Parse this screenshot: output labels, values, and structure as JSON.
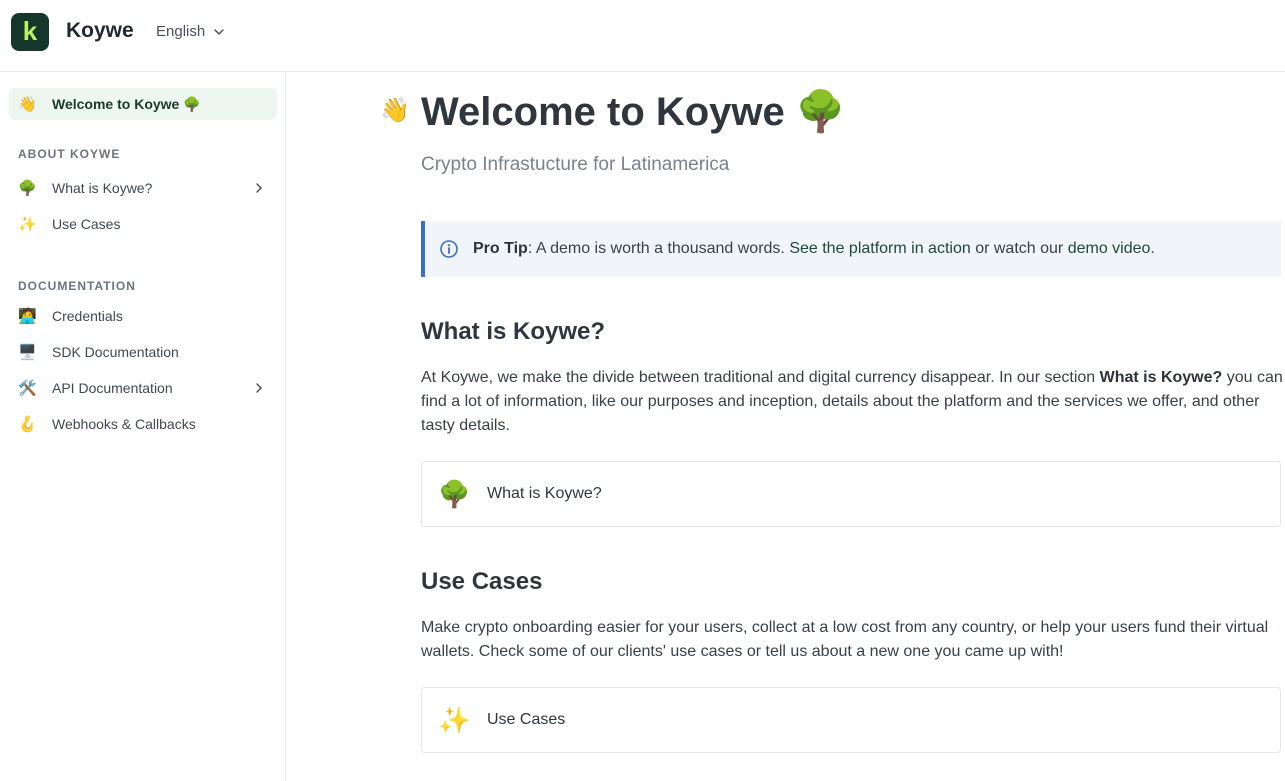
{
  "header": {
    "logo_letter": "k",
    "brand": "Koywe",
    "language": "English"
  },
  "sidebar": {
    "active": {
      "emoji": "👋",
      "label": "Welcome to Koywe 🌳"
    },
    "sections": [
      {
        "title": "ABOUT KOYWE",
        "items": [
          {
            "emoji": "🌳",
            "label": "What is Koywe?",
            "has_children": true
          },
          {
            "emoji": "✨",
            "label": "Use Cases",
            "has_children": false
          }
        ]
      },
      {
        "title": "DOCUMENTATION",
        "items": [
          {
            "emoji": "🧑‍💻",
            "label": "Credentials",
            "has_children": false
          },
          {
            "emoji": "🖥️",
            "label": "SDK Documentation",
            "has_children": false
          },
          {
            "emoji": "🛠️",
            "label": "API Documentation",
            "has_children": true
          },
          {
            "emoji": "🪝",
            "label": "Webhooks & Callbacks",
            "has_children": false
          }
        ]
      }
    ]
  },
  "main": {
    "title_emoji": "👋",
    "title": "Welcome to Koywe 🌳",
    "subtitle": "Crypto Infrastucture for Latinamerica",
    "callout": {
      "bold": "Pro Tip",
      "text_before": ": A demo is worth a thousand words. ",
      "link1": "See the platform in action",
      "text_mid": " or watch our ",
      "link2": "demo video",
      "text_after": "."
    },
    "section1": {
      "heading": "What is Koywe?",
      "para_before": "At Koywe, we make the divide between traditional and digital currency disappear. In our section ",
      "para_bold": "What is Koywe?",
      "para_after": " you can find a lot of information, like our purposes and inception, details about the platform and the services we offer, and other tasty details.",
      "card_emoji": "🌳",
      "card_label": "What is Koywe?"
    },
    "section2": {
      "heading": "Use Cases",
      "para": "Make crypto onboarding easier for your users, collect at a low cost from any country, or help your users fund their virtual wallets. Check some of our clients' use cases or tell us about a new one you came up with!",
      "card_emoji": "✨",
      "card_label": "Use Cases"
    }
  },
  "colors": {
    "accent": "#16352b",
    "logo_text": "#b8f35a",
    "callout_border": "#3b6fc4",
    "active_bg": "#eef6f2"
  }
}
